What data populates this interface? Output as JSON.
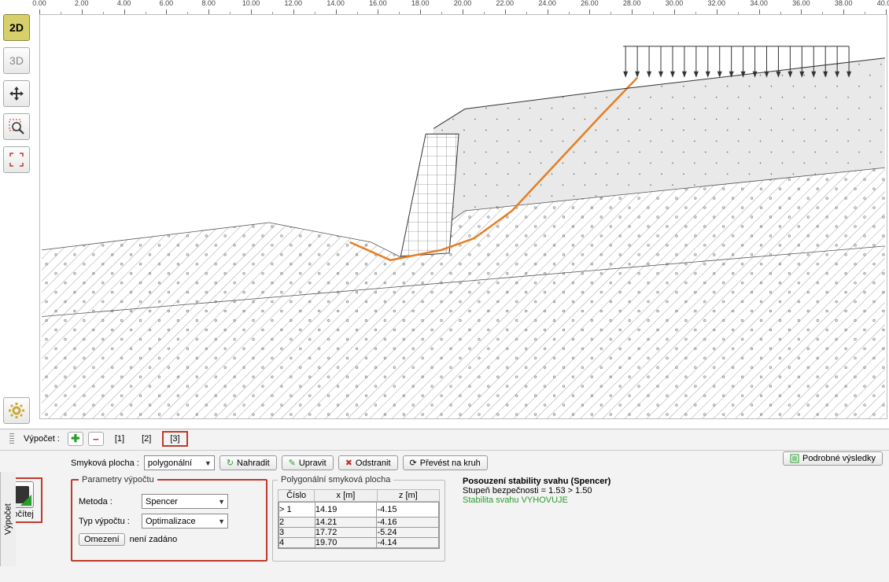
{
  "ruler": {
    "start": 0,
    "end": 40,
    "step_major": 2,
    "step_minor": 1
  },
  "toolbar_left": {
    "view2d": "2D",
    "view3d": "3D"
  },
  "tabs": {
    "label": "Výpočet :",
    "items": [
      "[1]",
      "[2]",
      "[3]"
    ],
    "selected_index": 2
  },
  "slip_row": {
    "label": "Smyková plocha :",
    "value": "polygonální",
    "btn_replace": "Nahradit",
    "btn_edit": "Upravit",
    "btn_delete": "Odstranit",
    "btn_convert": "Převést na kruh"
  },
  "params": {
    "legend": "Parametry výpočtu",
    "method_label": "Metoda :",
    "method_value": "Spencer",
    "type_label": "Typ výpočtu :",
    "type_value": "Optimalizace",
    "limit_btn": "Omezení",
    "limit_text": "není zadáno"
  },
  "poly_table": {
    "legend": "Polygonální smyková plocha",
    "headers": [
      "Číslo",
      "x [m]",
      "z [m]"
    ],
    "rows": [
      {
        "n": 1,
        "x": "14.19",
        "z": "-4.15"
      },
      {
        "n": 2,
        "x": "14.21",
        "z": "-4.16"
      },
      {
        "n": 3,
        "x": "17.72",
        "z": "-5.24"
      },
      {
        "n": 4,
        "x": "19.70",
        "z": "-4.14"
      }
    ],
    "selected_row": 0
  },
  "results": {
    "title": "Posouzení stability svahu (Spencer)",
    "line1": "Stupeň bezpečnosti = 1.53 > 1.50",
    "line2": "Stabilita svahu VYHOVUJE"
  },
  "pocitej_label": "Počítej",
  "podrobne_label": "Podrobné výsledky",
  "side_tab": "Výpočet"
}
